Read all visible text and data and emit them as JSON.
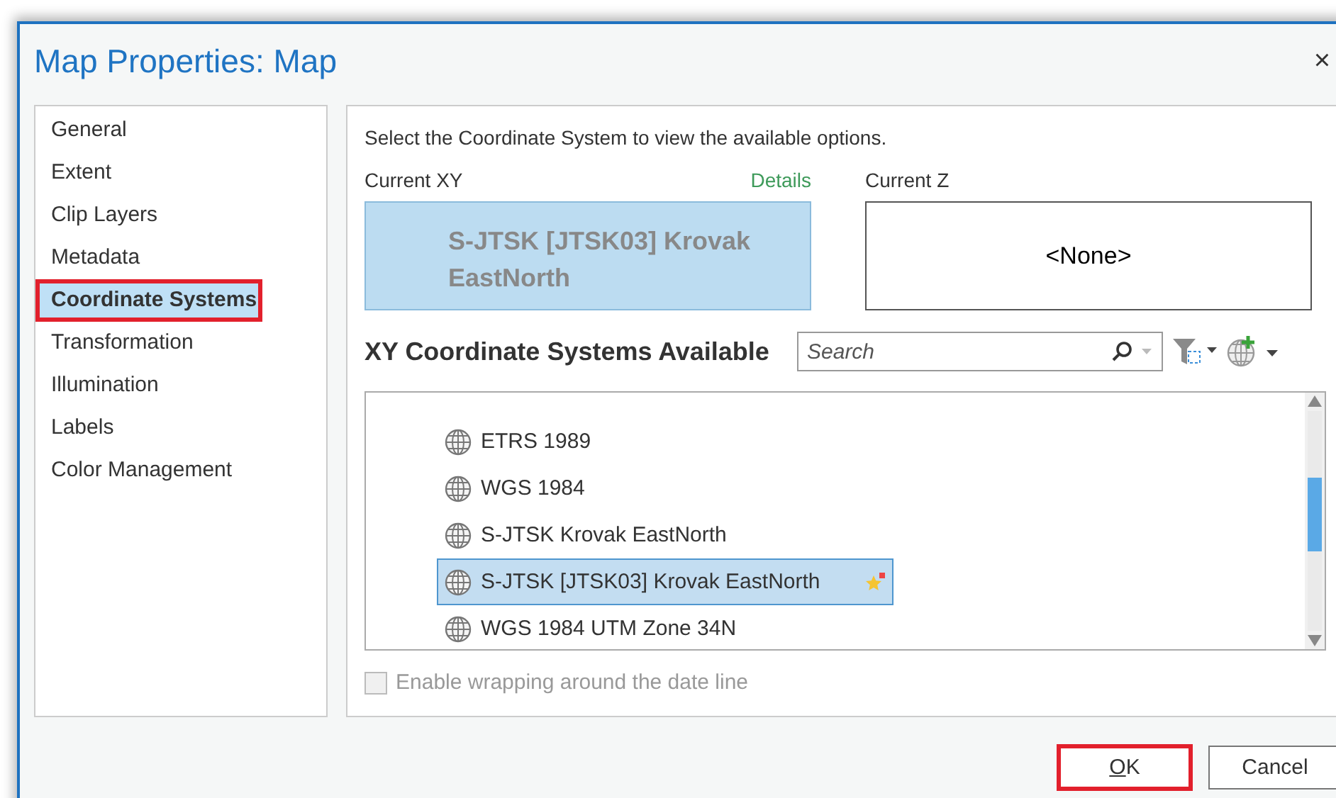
{
  "window": {
    "title": "Map Properties: Map",
    "close": "×"
  },
  "sidebar": {
    "items": [
      {
        "label": "General",
        "selected": false,
        "annotated": false
      },
      {
        "label": "Extent",
        "selected": false,
        "annotated": false
      },
      {
        "label": "Clip Layers",
        "selected": false,
        "annotated": false
      },
      {
        "label": "Metadata",
        "selected": false,
        "annotated": false
      },
      {
        "label": "Coordinate Systems",
        "selected": true,
        "annotated": true
      },
      {
        "label": "Transformation",
        "selected": false,
        "annotated": false
      },
      {
        "label": "Illumination",
        "selected": false,
        "annotated": false
      },
      {
        "label": "Labels",
        "selected": false,
        "annotated": false
      },
      {
        "label": "Color Management",
        "selected": false,
        "annotated": false
      }
    ]
  },
  "instruction": "Select the Coordinate System to view the available options.",
  "current_xy": {
    "label": "Current XY",
    "link": "Details",
    "value": "S-JTSK [JTSK03] Krovak EastNorth"
  },
  "current_z": {
    "label": "Current Z",
    "value": "<None>"
  },
  "available": {
    "heading": "XY Coordinate Systems Available",
    "search": {
      "placeholder": "Search"
    },
    "items": [
      {
        "label": "ETRS 1989",
        "selected": false,
        "favorite": false
      },
      {
        "label": "WGS 1984",
        "selected": false,
        "favorite": false
      },
      {
        "label": "S-JTSK Krovak EastNorth",
        "selected": false,
        "favorite": false
      },
      {
        "label": "S-JTSK [JTSK03] Krovak EastNorth",
        "selected": true,
        "favorite": true
      },
      {
        "label": "WGS 1984 UTM Zone 34N",
        "selected": false,
        "favorite": false
      }
    ]
  },
  "wrap_option": {
    "label": "Enable wrapping around the date line",
    "checked": false,
    "disabled": true
  },
  "buttons": [
    {
      "mnemonic": "O",
      "rest": "K",
      "annotated": true
    },
    {
      "rest": "Cancel",
      "annotated": false
    }
  ]
}
